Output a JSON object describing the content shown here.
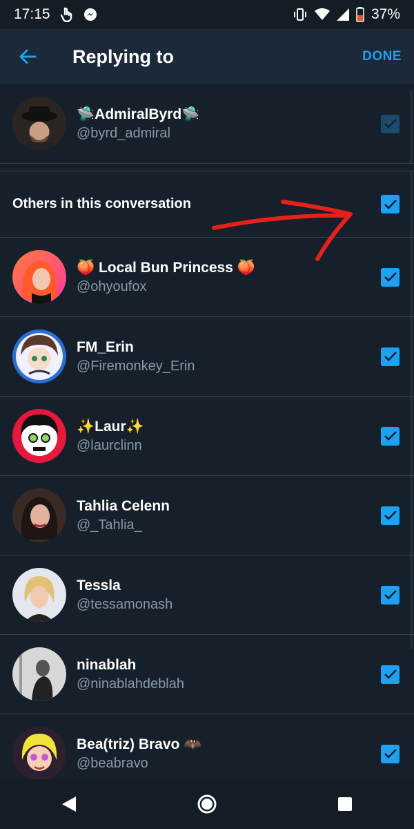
{
  "status_bar": {
    "time": "17:15",
    "battery": "37%",
    "icons": [
      "hand-icon",
      "messenger-icon",
      "vibrate-icon",
      "wifi-icon",
      "signal-icon",
      "battery-icon"
    ]
  },
  "header": {
    "title": "Replying to",
    "done_label": "DONE",
    "back_icon": "arrow-left-icon"
  },
  "primary_user": {
    "name": "🛸AdmiralByrd🛸",
    "handle": "@byrd_admiral",
    "checked": true
  },
  "section": {
    "label": "Others in this conversation",
    "checked": true
  },
  "users": [
    {
      "name": "🍑 Local Bun Princess 🍑",
      "handle": "@ohyoufox",
      "checked": true
    },
    {
      "name": "FM_Erin",
      "handle": "@Firemonkey_Erin",
      "checked": true
    },
    {
      "name": "✨Laur✨",
      "handle": "@laurclinn",
      "checked": true
    },
    {
      "name": "Tahlia Celenn",
      "handle": "@_Tahlia_",
      "checked": true
    },
    {
      "name": "Tessla",
      "handle": "@tessamonash",
      "checked": true
    },
    {
      "name": "ninablah",
      "handle": "@ninablahdeblah",
      "checked": true
    },
    {
      "name": "Bea(triz) Bravo 🦇",
      "handle": "@beabravo",
      "checked": true
    }
  ],
  "colors": {
    "background": "#15202b",
    "app_bar": "#1c2938",
    "accent": "#1da1f2",
    "secondary_text": "#8899a6",
    "annotation_arrow": "#e8201c"
  },
  "nav": {
    "icons": [
      "back-triangle-icon",
      "home-circle-icon",
      "recents-square-icon"
    ]
  }
}
